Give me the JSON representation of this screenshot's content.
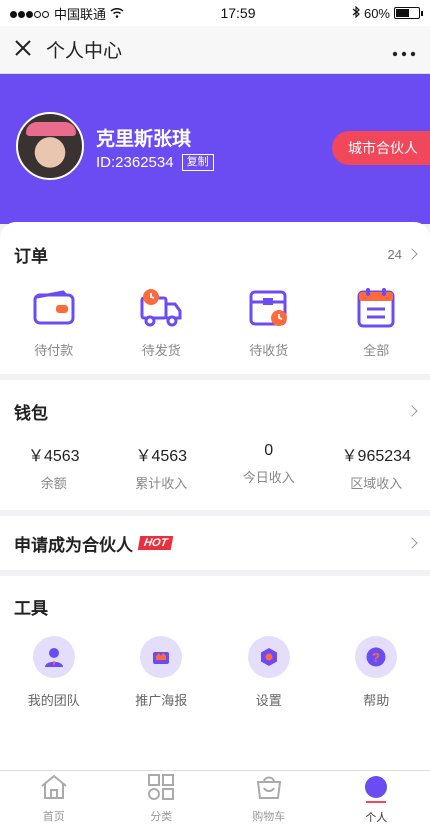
{
  "status_bar": {
    "carrier": "中国联通",
    "time": "17:59",
    "battery": "60%"
  },
  "nav": {
    "title": "个人中心",
    "close_icon": "close-icon",
    "more_icon": "more-icon"
  },
  "profile": {
    "name": "克里斯张琪",
    "id": "ID:2362534",
    "copy_label": "复制",
    "badge": "城市合伙人"
  },
  "orders": {
    "title": "订单",
    "count": "24",
    "items": [
      {
        "label": "待付款",
        "icon": "wallet-icon"
      },
      {
        "label": "待发货",
        "icon": "truck-icon"
      },
      {
        "label": "待收货",
        "icon": "box-icon"
      },
      {
        "label": "全部",
        "icon": "clipboard-icon"
      }
    ]
  },
  "wallet": {
    "title": "钱包",
    "items": [
      {
        "value": "￥4563",
        "label": "余额"
      },
      {
        "value": "￥4563",
        "label": "累计收入"
      },
      {
        "value": "0",
        "label": "今日收入"
      },
      {
        "value": "￥965234",
        "label": "区域收入"
      }
    ]
  },
  "apply": {
    "label": "申请成为合伙人",
    "hot": "HOT"
  },
  "tools": {
    "title": "工具",
    "items": [
      {
        "label": "我的团队",
        "icon": "team-icon"
      },
      {
        "label": "推广海报",
        "icon": "poster-icon"
      },
      {
        "label": "设置",
        "icon": "settings-icon"
      },
      {
        "label": "帮助",
        "icon": "help-icon"
      }
    ]
  },
  "tabbar": [
    {
      "label": "首页",
      "icon": "home-icon"
    },
    {
      "label": "分类",
      "icon": "category-icon"
    },
    {
      "label": "购物车",
      "icon": "cart-icon"
    },
    {
      "label": "个人",
      "icon": "user-icon"
    }
  ],
  "colors": {
    "primary": "#6b4cf2",
    "accent": "#f0475a",
    "orange": "#ff6a3d"
  }
}
